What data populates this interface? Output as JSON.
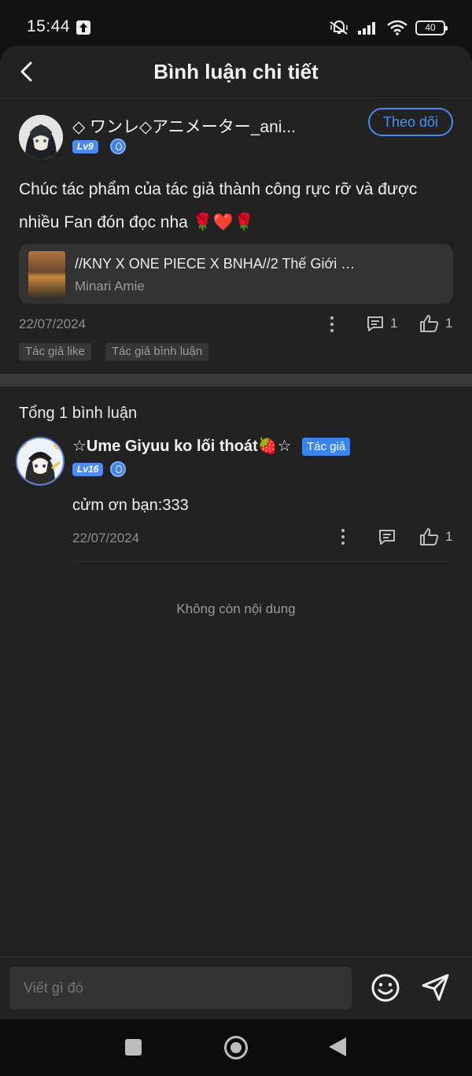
{
  "status_bar": {
    "time": "15:44",
    "battery": "40"
  },
  "header": {
    "title": "Bình luận chi tiết"
  },
  "post": {
    "username": "◇ ワンレ◇アニメーター_ani...",
    "level": "Lv9",
    "follow_label": "Theo dõi",
    "text": "Chúc tác phẩm của tác giả thành công rực rỡ và được nhiều Fan đón đọc nha 🌹❤️🌹",
    "work": {
      "title": "//KNY X ONE PIECE X BNHA//2 Thế Giới P...",
      "author": "Minari Amie"
    },
    "date": "22/07/2024",
    "comment_count": "1",
    "like_count": "1",
    "tags": [
      "Tác giả like",
      "Tác giả bình luận"
    ]
  },
  "comments_section": {
    "total_label": "Tổng 1 bình luận",
    "reply": {
      "username": "☆Ume Giyuu ko lối thoát🍓☆",
      "author_badge": "Tác giả",
      "level": "Lv16",
      "text": "cửm ơn bạn:333",
      "date": "22/07/2024",
      "like_count": "1"
    },
    "end_note": "Không còn nội dung"
  },
  "composer": {
    "placeholder": "Viết gì đó"
  },
  "colors": {
    "accent": "#4a88f0",
    "background": "#222222",
    "divider": "#3a3a3a"
  }
}
